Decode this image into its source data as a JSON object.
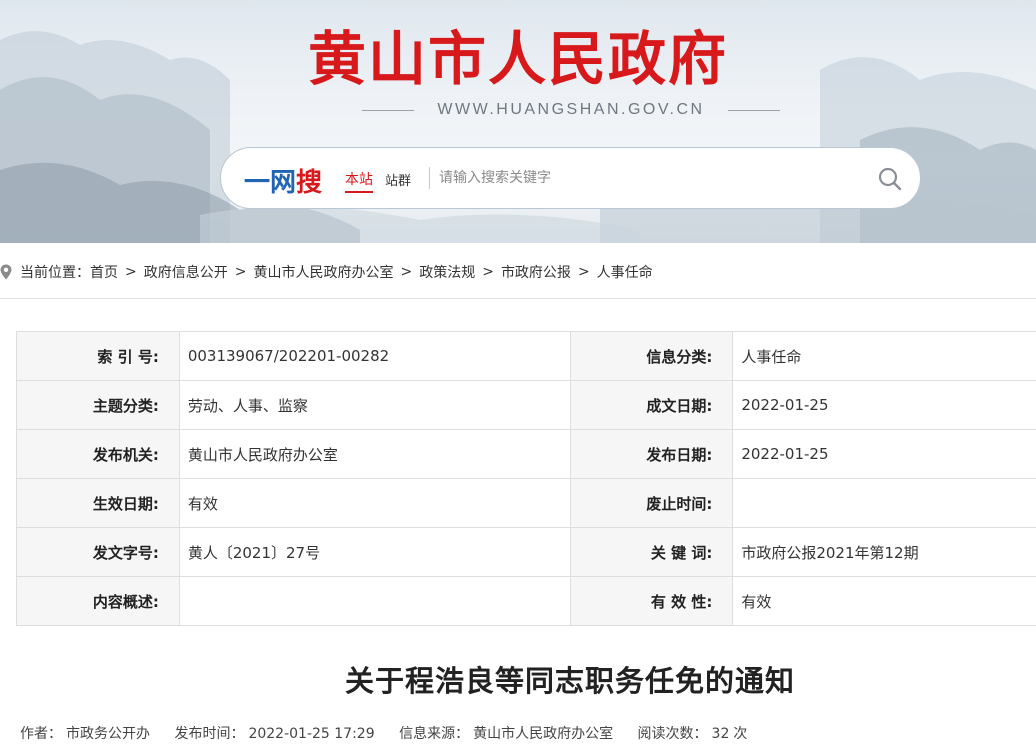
{
  "site": {
    "title": "黄山市人民政府",
    "url": "WWW.HUANGSHAN.GOV.CN",
    "brand_color": "#d7191c"
  },
  "search": {
    "logo_part1": "一网",
    "logo_part2": "搜",
    "scope_active": "本站",
    "scope_other": "站群",
    "placeholder": "请输入搜索关键字",
    "button_icon": "search-icon"
  },
  "breadcrumb": {
    "label": "当前位置：",
    "items": [
      "首页",
      "政府信息公开",
      "黄山市人民政府办公室",
      "政策法规",
      "市政府公报",
      "人事任命"
    ],
    "separator": ">",
    "icon": "location-pin-icon"
  },
  "meta": {
    "rows": [
      {
        "k1": "索 引 号:",
        "v1": "003139067/202201-00282",
        "k2": "信息分类:",
        "v2": "人事任命"
      },
      {
        "k1": "主题分类:",
        "v1": "劳动、人事、监察",
        "k2": "成文日期:",
        "v2": "2022-01-25"
      },
      {
        "k1": "发布机关:",
        "v1": "黄山市人民政府办公室",
        "k2": "发布日期:",
        "v2": "2022-01-25"
      },
      {
        "k1": "生效日期:",
        "v1": "有效",
        "k2": "废止时间:",
        "v2": ""
      },
      {
        "k1": "发文字号:",
        "v1": "黄人〔2021〕27号",
        "k2": "关 键 词:",
        "v2": "市政府公报2021年第12期"
      },
      {
        "k1": "内容概述:",
        "v1": "",
        "k2": "有 效 性:",
        "v2": "有效"
      }
    ]
  },
  "article": {
    "title": "关于程浩良等同志职务任免的通知",
    "author_label": "作者：",
    "author": "市政务公开办",
    "time_label": "发布时间：",
    "time": "2022-01-25 17:29",
    "source_label": "信息来源：",
    "source": "黄山市人民政府办公室",
    "reads_label": "阅读次数：",
    "reads": "32",
    "reads_unit": "次"
  }
}
